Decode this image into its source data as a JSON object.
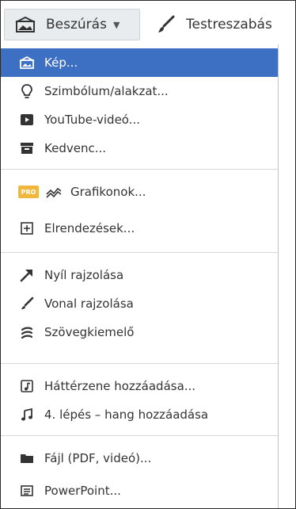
{
  "toolbar": {
    "insert_label": "Beszúrás",
    "customize_label": "Testreszabás"
  },
  "menu": {
    "items": [
      {
        "label": "Kép...",
        "icon": "image-icon"
      },
      {
        "label": "Szimbólum/alakzat...",
        "icon": "lightbulb-icon"
      },
      {
        "label": "YouTube-videó...",
        "icon": "youtube-icon"
      },
      {
        "label": "Kedvenc...",
        "icon": "archive-icon"
      },
      {
        "label": "Grafikonok...",
        "icon": "chart-icon",
        "badge": "PRO"
      },
      {
        "label": "Elrendezések...",
        "icon": "plus-square-icon"
      },
      {
        "label": "Nyíl rajzolása",
        "icon": "arrow-icon"
      },
      {
        "label": "Vonal rajzolása",
        "icon": "line-icon"
      },
      {
        "label": "Szövegkiemelő",
        "icon": "highlighter-icon"
      },
      {
        "label": "Háttérzene hozzáadása...",
        "icon": "music-file-icon"
      },
      {
        "label": "4. lépés – hang hozzáadása",
        "icon": "music-note-icon"
      },
      {
        "label": "Fájl (PDF, videó)...",
        "icon": "folder-icon"
      },
      {
        "label": "PowerPoint...",
        "icon": "powerpoint-icon"
      }
    ]
  },
  "colors": {
    "active": "#3d6fc3",
    "pro_badge": "#f0b73b"
  }
}
